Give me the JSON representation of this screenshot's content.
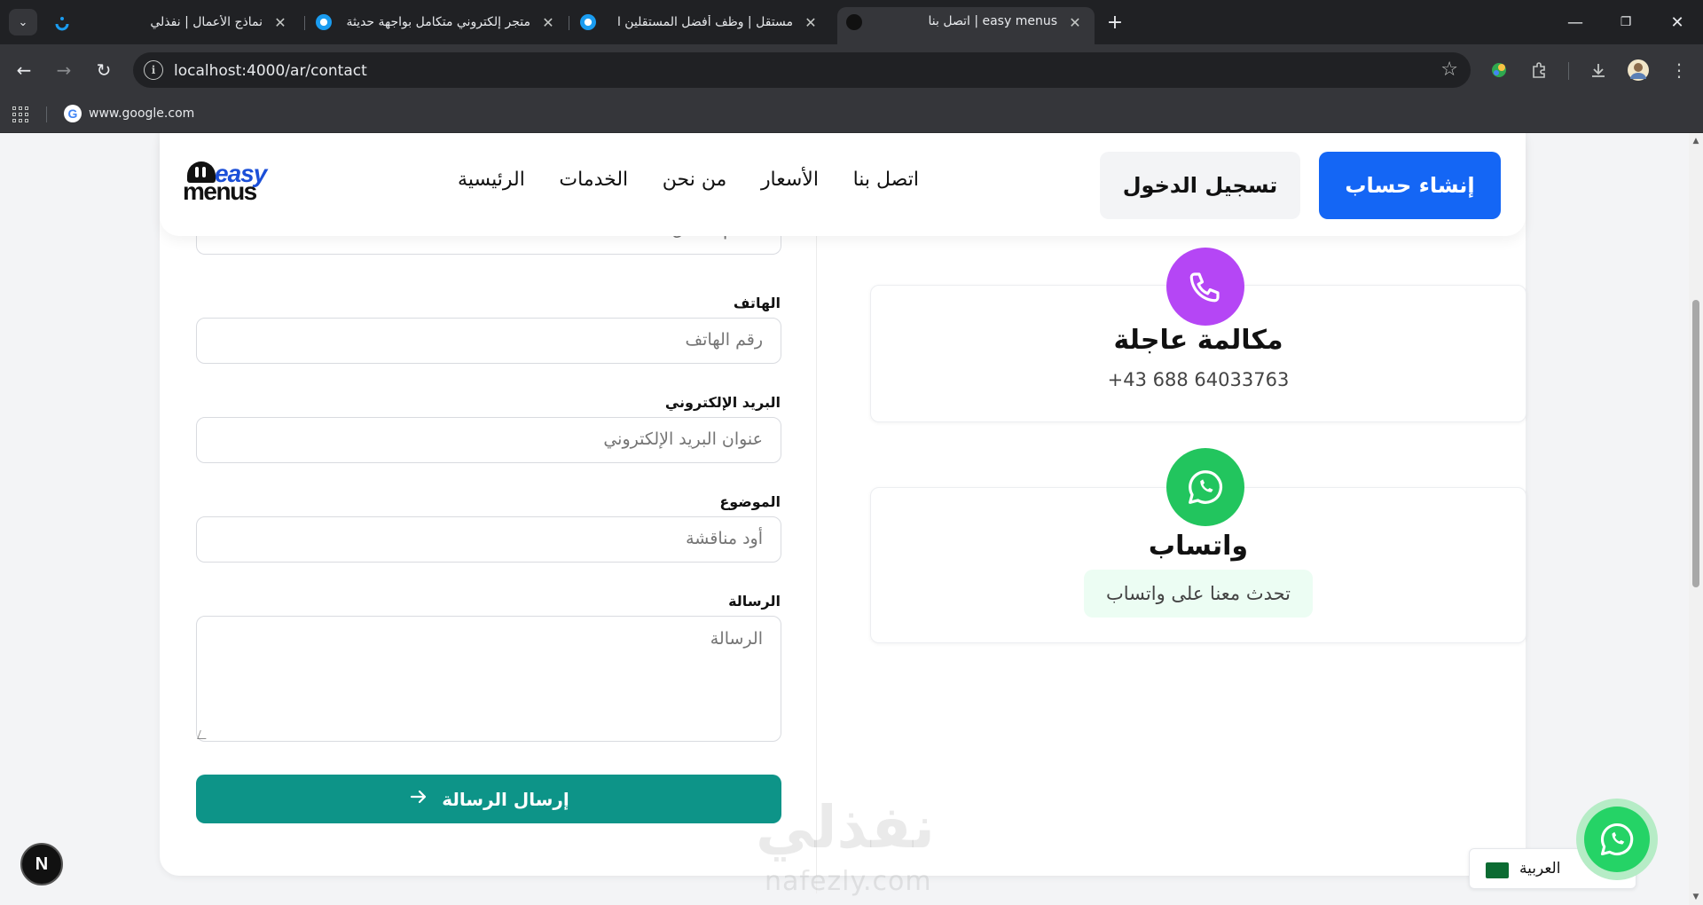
{
  "browser": {
    "tabs": [
      {
        "title": "نماذج الأعمال | نفذلي",
        "active": false
      },
      {
        "title": "متجر إلكتروني متكامل بواجهة حديثة",
        "active": false
      },
      {
        "title": "مستقل | وظف أفضل المستقلين ا",
        "active": false
      },
      {
        "title": "easy menus | اتصل بنا",
        "active": true
      }
    ],
    "url": "localhost:4000/ar/contact",
    "bookmarks": [
      {
        "label": "www.google.com",
        "icon": "G"
      }
    ]
  },
  "navbar": {
    "logo": {
      "top": "easy",
      "bottom": "menus"
    },
    "links": [
      "الرئيسية",
      "الخدمات",
      "من نحن",
      "الأسعار",
      "اتصل بنا"
    ],
    "login_label": "تسجيل الدخول",
    "register_label": "إنشاء حساب",
    "brand_color": "#1466f5"
  },
  "form": {
    "name_placeholder": "الاسم الكامل",
    "phone_label": "الهاتف",
    "phone_placeholder": "رقم الهاتف",
    "email_label": "البريد الإلكتروني",
    "email_placeholder": "عنوان البريد الإلكتروني",
    "subject_label": "الموضوع",
    "subject_placeholder": "أود مناقشة",
    "message_label": "الرسالة",
    "message_placeholder": "الرسالة",
    "submit_label": "إرسال الرسالة",
    "submit_color": "#0d9488"
  },
  "contact_cards": {
    "call": {
      "title": "مكالمة عاجلة",
      "value": "+43 688 64033763",
      "icon": "phone-icon",
      "color": "#b546f5"
    },
    "whatsapp": {
      "title": "واتساب",
      "cta": "تحدث معنا على واتساب",
      "icon": "whatsapp-icon",
      "color": "#22c55e"
    }
  },
  "watermark": {
    "ar": "نفذلي",
    "en": "nafezly.com"
  },
  "widgets": {
    "n_badge": "N",
    "language": "العربية"
  }
}
